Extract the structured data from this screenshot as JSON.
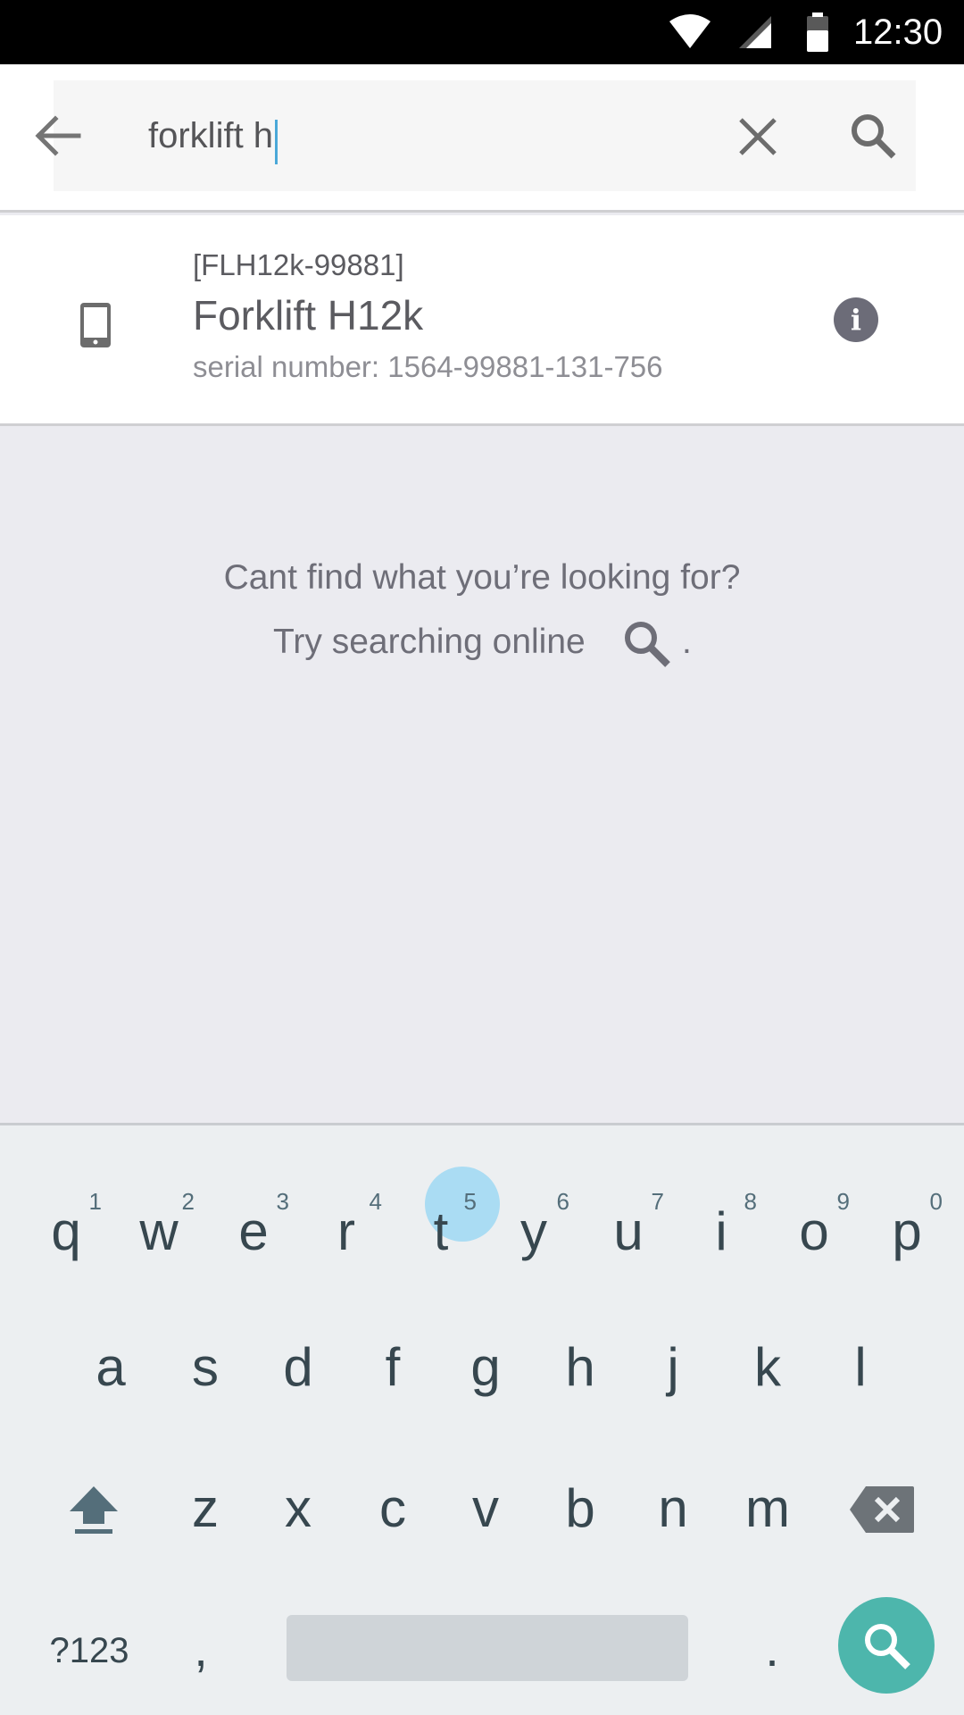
{
  "status_bar": {
    "time": "12:30"
  },
  "search": {
    "query": "forklift h",
    "back_icon": "arrow-back-icon",
    "clear_icon": "close-icon",
    "search_icon": "search-icon"
  },
  "result": {
    "code": "[FLH12k-99881]",
    "title": "Forklift H12k",
    "serial": "serial number: 1564-99881-131-756",
    "device_icon": "phone-device-icon",
    "info_label": "i"
  },
  "empty_state": {
    "line1": "Cant find what you’re looking for?",
    "line2": "Try searching online",
    "line2_suffix": "."
  },
  "keyboard": {
    "row1": [
      {
        "key": "q",
        "hint": "1"
      },
      {
        "key": "w",
        "hint": "2"
      },
      {
        "key": "e",
        "hint": "3"
      },
      {
        "key": "r",
        "hint": "4"
      },
      {
        "key": "t",
        "hint": "5"
      },
      {
        "key": "y",
        "hint": "6"
      },
      {
        "key": "u",
        "hint": "7"
      },
      {
        "key": "i",
        "hint": "8"
      },
      {
        "key": "o",
        "hint": "9"
      },
      {
        "key": "p",
        "hint": "0"
      }
    ],
    "row2": [
      "a",
      "s",
      "d",
      "f",
      "g",
      "h",
      "j",
      "k",
      "l"
    ],
    "row3": [
      "z",
      "x",
      "c",
      "v",
      "b",
      "n",
      "m"
    ],
    "symbols_label": "?123",
    "comma": ",",
    "period": ".",
    "pressed_key": "t",
    "accent_color": "#4db6ac"
  }
}
